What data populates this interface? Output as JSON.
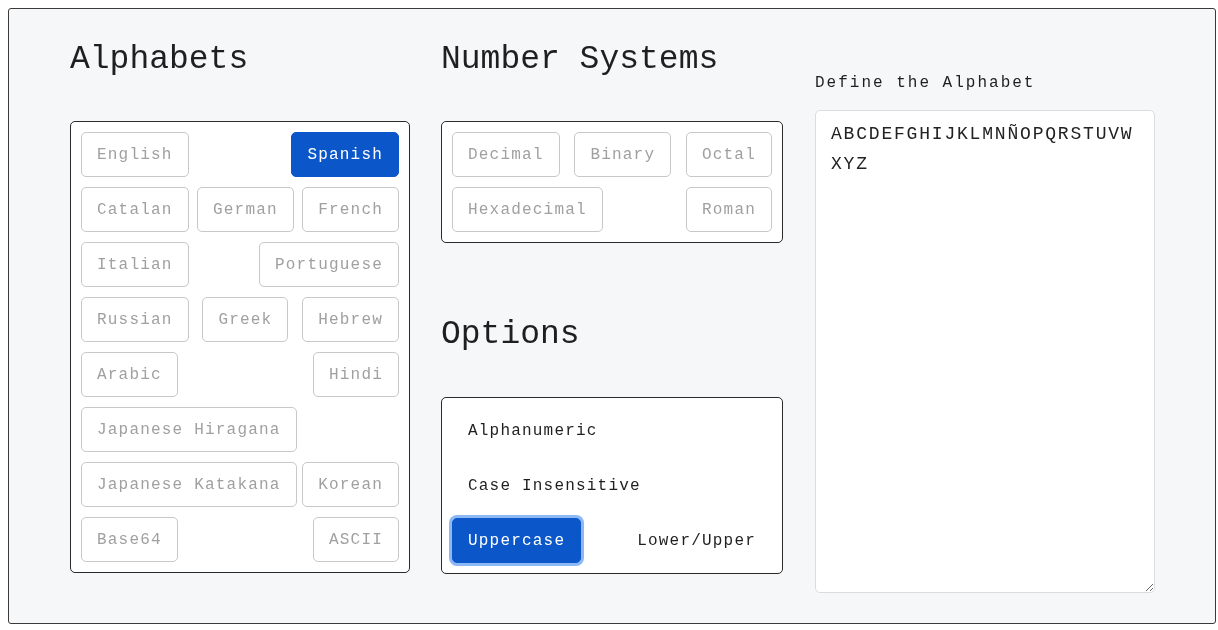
{
  "alphabets": {
    "title": "Alphabets",
    "items": [
      {
        "label": "English",
        "selected": false
      },
      {
        "label": "Spanish",
        "selected": true
      },
      {
        "label": "Catalan",
        "selected": false
      },
      {
        "label": "German",
        "selected": false
      },
      {
        "label": "French",
        "selected": false
      },
      {
        "label": "Italian",
        "selected": false
      },
      {
        "label": "Portuguese",
        "selected": false
      },
      {
        "label": "Russian",
        "selected": false
      },
      {
        "label": "Greek",
        "selected": false
      },
      {
        "label": "Hebrew",
        "selected": false
      },
      {
        "label": "Arabic",
        "selected": false
      },
      {
        "label": "Hindi",
        "selected": false
      },
      {
        "label": "Japanese Hiragana",
        "selected": false
      },
      {
        "label": "Japanese Katakana",
        "selected": false
      },
      {
        "label": "Korean",
        "selected": false
      },
      {
        "label": "Base64",
        "selected": false
      },
      {
        "label": "ASCII",
        "selected": false
      }
    ]
  },
  "number_systems": {
    "title": "Number Systems",
    "items": [
      {
        "label": "Decimal",
        "selected": false
      },
      {
        "label": "Binary",
        "selected": false
      },
      {
        "label": "Octal",
        "selected": false
      },
      {
        "label": "Hexadecimal",
        "selected": false
      },
      {
        "label": "Roman",
        "selected": false
      }
    ]
  },
  "options": {
    "title": "Options",
    "items": [
      {
        "label": "Alphanumeric",
        "selected": false
      },
      {
        "label": "Case Insensitive",
        "selected": false
      },
      {
        "label": "Uppercase",
        "selected": true
      },
      {
        "label": "Lower/Upper",
        "selected": false
      }
    ]
  },
  "define": {
    "label": "Define the Alphabet",
    "value": "ABCDEFGHIJKLMNÑOPQRSTUVWXYZ"
  }
}
